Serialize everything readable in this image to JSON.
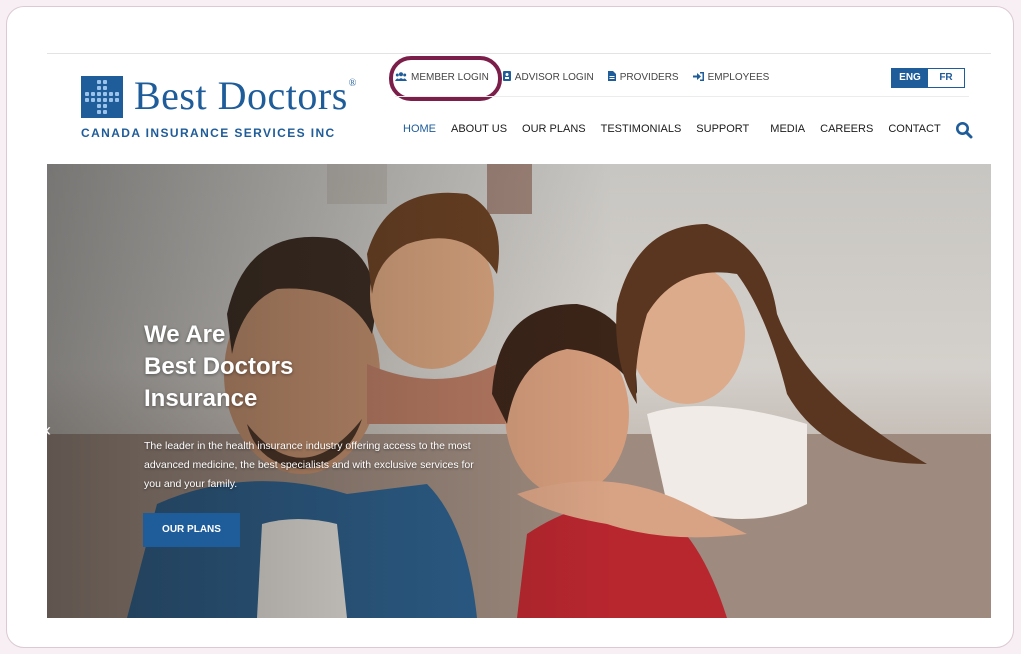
{
  "logo": {
    "name": "Best Doctors",
    "registered": "®",
    "subtitle": "CANADA INSURANCE SERVICES INC"
  },
  "utility_links": [
    {
      "label": "MEMBER LOGIN",
      "icon": "users-icon"
    },
    {
      "label": "ADVISOR LOGIN",
      "icon": "id-card-icon"
    },
    {
      "label": "PROVIDERS",
      "icon": "file-icon"
    },
    {
      "label": "EMPLOYEES",
      "icon": "sign-in-icon"
    }
  ],
  "language": {
    "active": "ENG",
    "inactive": "FR"
  },
  "nav": [
    "HOME",
    "ABOUT US",
    "OUR PLANS",
    "TESTIMONIALS",
    "SUPPORT",
    "MEDIA",
    "CAREERS",
    "CONTACT"
  ],
  "hero": {
    "title_lines": [
      "We Are",
      "Best Doctors",
      "Insurance"
    ],
    "description": "The leader in the health insurance industry offering access to the most advanced medicine, the best specialists and with exclusive services for you and your family.",
    "button": "OUR PLANS"
  },
  "colors": {
    "brand": "#1e5c9a",
    "highlight": "#7b1f4a"
  }
}
